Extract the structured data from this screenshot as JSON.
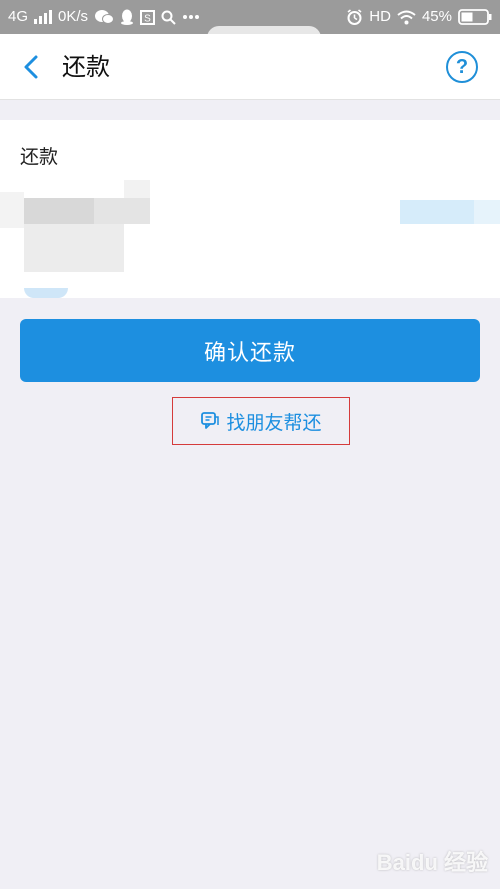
{
  "status_bar": {
    "network": "4G",
    "speed": "0K/s",
    "hd": "HD",
    "battery": "45%",
    "icons": [
      "signal-icon",
      "wechat-icon",
      "qq-icon",
      "s-app-icon",
      "search-icon",
      "more-dots-icon",
      "alarm-icon",
      "wifi-icon",
      "battery-icon"
    ]
  },
  "header": {
    "title": "还款",
    "back_icon": "chevron-left-icon",
    "help_label": "?"
  },
  "card": {
    "label": "还款"
  },
  "actions": {
    "confirm_label": "确认还款",
    "friend_help_label": "找朋友帮还"
  },
  "watermark": {
    "text": "Baidu 经验"
  },
  "colors": {
    "accent": "#1d8fe0",
    "highlight_box": "#d53b3b",
    "page_bg": "#f0eff5",
    "status_bar_bg": "#9b9b9b"
  }
}
